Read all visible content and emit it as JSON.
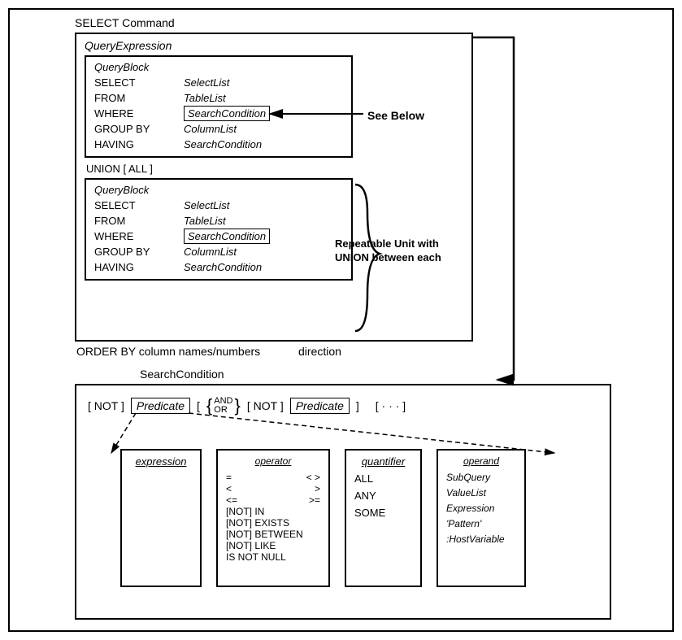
{
  "title": "SELECT Command",
  "queryExpression": {
    "label": "QueryExpression",
    "block1": {
      "title": "QueryBlock",
      "select": {
        "key": "SELECT",
        "val": "SelectList"
      },
      "from": {
        "key": "FROM",
        "val": "TableList"
      },
      "where": {
        "key": "WHERE",
        "val": "SearchCondition"
      },
      "groupby": {
        "key": "GROUP BY",
        "val": "ColumnList"
      },
      "having": {
        "key": "HAVING",
        "val": "SearchCondition"
      }
    },
    "union": "UNION [ ALL ]",
    "block2": {
      "title": "QueryBlock",
      "select": {
        "key": "SELECT",
        "val": "SelectList"
      },
      "from": {
        "key": "FROM",
        "val": "TableList"
      },
      "where": {
        "key": "WHERE",
        "val": "SearchCondition"
      },
      "groupby": {
        "key": "GROUP BY",
        "val": "ColumnList"
      },
      "having": {
        "key": "HAVING",
        "val": "SearchCondition"
      }
    }
  },
  "seeBelow": "See Below",
  "repeatable": "Repeatable Unit with UNION between each",
  "orderBy": "ORDER BY column names/numbers",
  "direction": "direction",
  "searchCondition": {
    "title": "SearchCondition",
    "line": {
      "not1": "[ NOT ]",
      "pred1": "Predicate",
      "lb": "[",
      "lbrace": "{",
      "and": "AND",
      "or": "OR",
      "rbrace": "}",
      "not2": "[ NOT ]",
      "pred2": "Predicate",
      "rb": "]",
      "dots": "[ · · · ]"
    },
    "expression": {
      "title": "expression"
    },
    "operator": {
      "title": "operator",
      "r1a": "=",
      "r1b": "< >",
      "r2a": "<",
      "r2b": ">",
      "r3a": "<=",
      "r3b": ">=",
      "in": "[NOT] IN",
      "exists": "[NOT] EXISTS",
      "between": "[NOT] BETWEEN",
      "like": "[NOT] LIKE",
      "isnull": "IS NOT NULL"
    },
    "quantifier": {
      "title": "quantifier",
      "all": "ALL",
      "any": "ANY",
      "some": "SOME"
    },
    "operand": {
      "title": "operand",
      "subquery": "SubQuery",
      "valuelist": "ValueList",
      "expression": "Expression",
      "pattern": "'Pattern'",
      "hostvar": ":HostVariable"
    }
  }
}
